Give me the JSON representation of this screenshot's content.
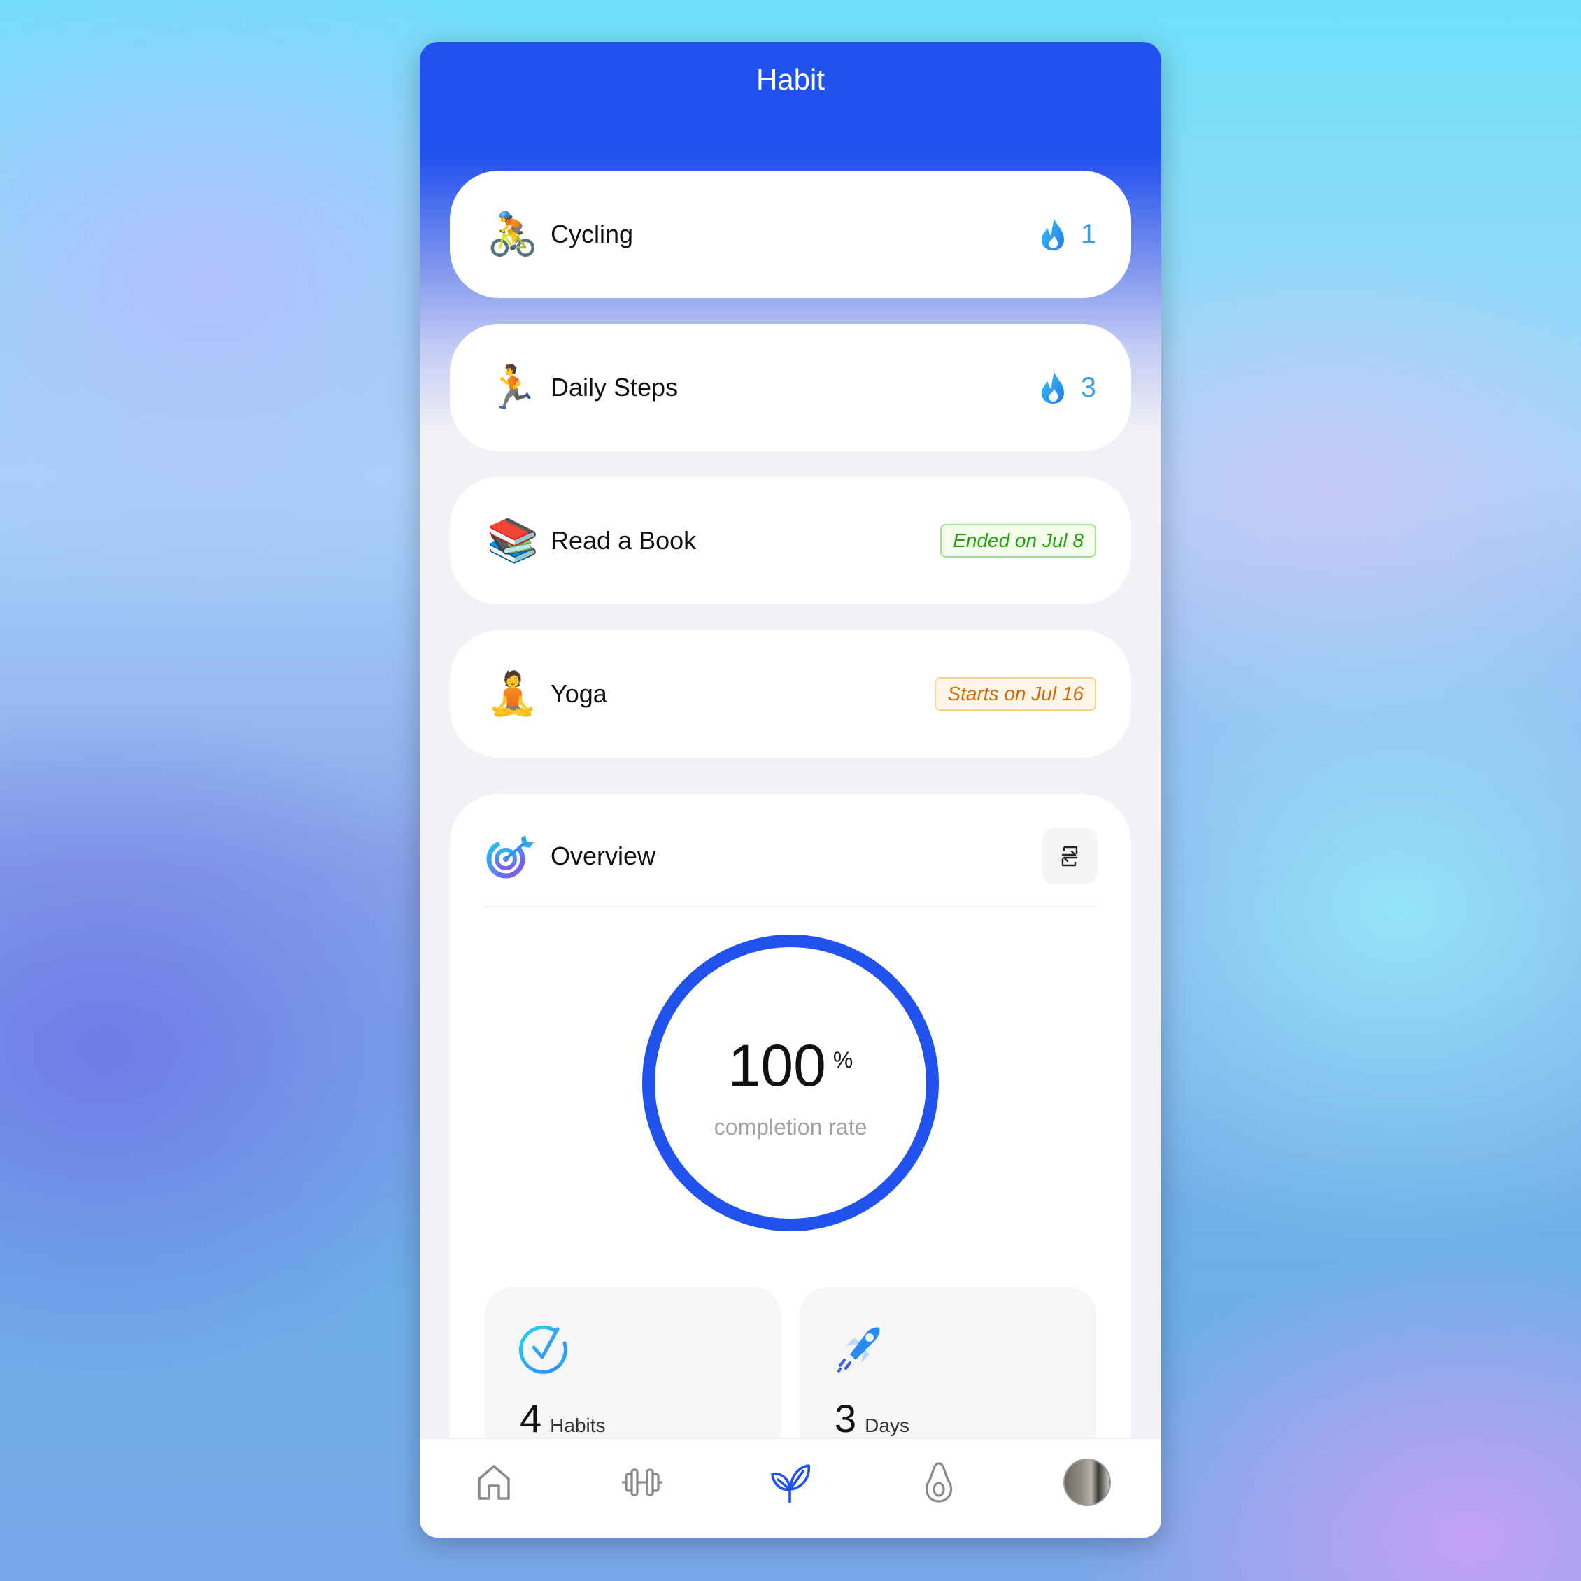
{
  "app": {
    "title": "Habit"
  },
  "habits": [
    {
      "emoji": "🚴",
      "name": "Cycling",
      "status": "streak",
      "streak": "1"
    },
    {
      "emoji": "🏃",
      "name": "Daily Steps",
      "status": "streak",
      "streak": "3"
    },
    {
      "emoji": "📚",
      "name": "Read a Book",
      "status": "ended",
      "badge": "Ended on Jul 8"
    },
    {
      "emoji": "🧘",
      "name": "Yoga",
      "status": "upcoming",
      "badge": "Starts on Jul 16"
    }
  ],
  "overview": {
    "title": "Overview",
    "icon": "target-icon",
    "swap_icon": "swap-icon",
    "completion_value": "100",
    "completion_unit": "%",
    "completion_fraction": 1.0,
    "completion_label": "completion rate",
    "stats": [
      {
        "icon": "check-circle-icon",
        "value": "4",
        "unit": "Habits"
      },
      {
        "icon": "rocket-icon",
        "value": "3",
        "unit": "Days"
      }
    ]
  },
  "nav": {
    "items": [
      {
        "name": "home",
        "icon": "home-icon",
        "active": false
      },
      {
        "name": "workout",
        "icon": "dumbbell-icon",
        "active": false
      },
      {
        "name": "habit",
        "icon": "sprout-icon",
        "active": true
      },
      {
        "name": "nutrition",
        "icon": "avocado-icon",
        "active": false
      },
      {
        "name": "profile",
        "icon": "avatar",
        "active": false
      }
    ]
  },
  "colors": {
    "accent": "#2252ee",
    "streak": "#3a9ee8",
    "ended": "#27a017",
    "upcoming": "#d46a10",
    "inactive_icon": "#8a8a8a"
  }
}
